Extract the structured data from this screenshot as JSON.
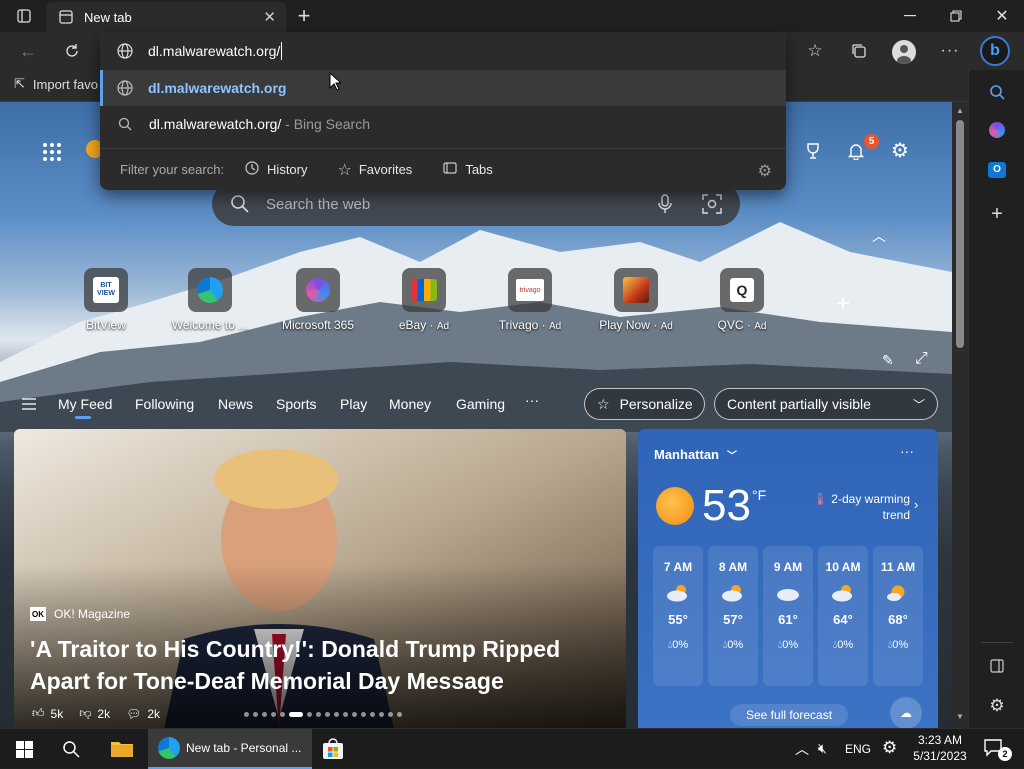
{
  "tab": {
    "title": "New tab"
  },
  "address": {
    "value": "dl.malwarewatch.org/"
  },
  "suggestions": [
    {
      "text": "dl.malwarewatch.org",
      "suffix": ""
    },
    {
      "text": "dl.malwarewatch.org/",
      "suffix": " - Bing Search"
    }
  ],
  "filter": {
    "label": "Filter your search:",
    "history": "History",
    "favorites": "Favorites",
    "tabs": "Tabs"
  },
  "favbar": {
    "import": "Import favo"
  },
  "search": {
    "placeholder": "Search the web"
  },
  "notifications": {
    "count": "5"
  },
  "tiles": [
    {
      "label": "BitView",
      "ad": ""
    },
    {
      "label": "Welcome to ...",
      "ad": ""
    },
    {
      "label": "Microsoft 365",
      "ad": ""
    },
    {
      "label": "eBay",
      "ad": "Ad"
    },
    {
      "label": "Trivago",
      "ad": "Ad"
    },
    {
      "label": "Play Now",
      "ad": "Ad"
    },
    {
      "label": "QVC",
      "ad": "Ad"
    }
  ],
  "feed_nav": [
    "My Feed",
    "Following",
    "News",
    "Sports",
    "Play",
    "Money",
    "Gaming"
  ],
  "personalize": "Personalize",
  "content_visibility": "Content partially visible",
  "hero": {
    "source": "OK! Magazine",
    "headline_line1": "'A Traitor to His Country!': Donald Trump Ripped",
    "headline_line2": "Apart for Tone-Deaf Memorial Day Message",
    "likes": "5k",
    "dislikes": "2k",
    "comments": "2k"
  },
  "weather": {
    "location": "Manhattan",
    "temp": "53",
    "unit": "°F",
    "trend_line1": "2-day warming",
    "trend_line2": "trend",
    "hours": [
      {
        "time": "7 AM",
        "temp": "55°",
        "precip": "0%"
      },
      {
        "time": "8 AM",
        "temp": "57°",
        "precip": "0%"
      },
      {
        "time": "9 AM",
        "temp": "61°",
        "precip": "0%"
      },
      {
        "time": "10 AM",
        "temp": "64°",
        "precip": "0%"
      },
      {
        "time": "11 AM",
        "temp": "68°",
        "precip": "0%"
      }
    ],
    "forecast_link": "See full forecast"
  },
  "taskbar": {
    "edge_label": "New tab - Personal ...",
    "lang": "ENG",
    "time": "3:23 AM",
    "date": "5/31/2023",
    "notif_count": "2"
  },
  "colors": {
    "accent": "#3b78d8",
    "weather_bg": "#2f64b8",
    "badge": "#e8572f"
  }
}
